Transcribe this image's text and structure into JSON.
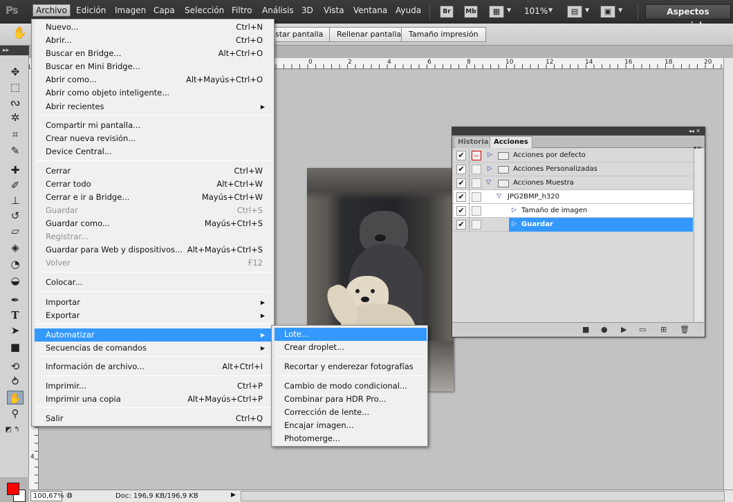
{
  "app": {
    "logo": "Ps",
    "workspace_label": "Aspectos esenciales",
    "zoom": "101%"
  },
  "menubar": [
    "Archivo",
    "Edición",
    "Imagen",
    "Capa",
    "Selección",
    "Filtro",
    "Análisis",
    "3D",
    "Vista",
    "Ventana",
    "Ayuda"
  ],
  "toolbar_boxes": {
    "bridge": "Br",
    "minibridge": "Mb"
  },
  "options_bar": {
    "buttons": [
      "star pantalla",
      "Rellenar pantalla",
      "Tamaño impresión"
    ]
  },
  "ruler": {
    "h_labels": [
      "0",
      "2",
      "4",
      "6",
      "8",
      "10",
      "12",
      "14",
      "16",
      "18",
      "20"
    ],
    "v_labels": [
      "4"
    ]
  },
  "status": {
    "zoom_value": "100,67%",
    "doc_info": "Doc: 196,9 KB/196,9 KB"
  },
  "file_menu": {
    "items": [
      {
        "label": "Nuevo...",
        "shortcut": "Ctrl+N"
      },
      {
        "label": "Abrir...",
        "shortcut": "Ctrl+O"
      },
      {
        "label": "Buscar en Bridge...",
        "shortcut": "Alt+Ctrl+O"
      },
      {
        "label": "Buscar en Mini Bridge...",
        "shortcut": ""
      },
      {
        "label": "Abrir como...",
        "shortcut": "Alt+Mayús+Ctrl+O"
      },
      {
        "label": "Abrir como objeto inteligente...",
        "shortcut": ""
      },
      {
        "label": "Abrir recientes",
        "shortcut": "",
        "submenu": true
      },
      {
        "label": "Compartir mi pantalla...",
        "shortcut": ""
      },
      {
        "label": "Crear nueva revisión...",
        "shortcut": ""
      },
      {
        "label": "Device Central...",
        "shortcut": ""
      },
      {
        "label": "Cerrar",
        "shortcut": "Ctrl+W"
      },
      {
        "label": "Cerrar todo",
        "shortcut": "Alt+Ctrl+W"
      },
      {
        "label": "Cerrar e ir a Bridge...",
        "shortcut": "Mayús+Ctrl+W"
      },
      {
        "label": "Guardar",
        "shortcut": "Ctrl+S",
        "disabled": true
      },
      {
        "label": "Guardar como...",
        "shortcut": "Mayús+Ctrl+S"
      },
      {
        "label": "Registrar...",
        "shortcut": "",
        "disabled": true
      },
      {
        "label": "Guardar para Web y dispositivos...",
        "shortcut": "Alt+Mayús+Ctrl+S"
      },
      {
        "label": "Volver",
        "shortcut": "F12",
        "disabled": true
      },
      {
        "label": "Colocar...",
        "shortcut": ""
      },
      {
        "label": "Importar",
        "shortcut": "",
        "submenu": true
      },
      {
        "label": "Exportar",
        "shortcut": "",
        "submenu": true
      },
      {
        "label": "Automatizar",
        "shortcut": "",
        "submenu": true,
        "highlighted": true
      },
      {
        "label": "Secuencias de comandos",
        "shortcut": "",
        "submenu": true
      },
      {
        "label": "Información de archivo...",
        "shortcut": "Alt+Ctrl+I"
      },
      {
        "label": "Imprimir...",
        "shortcut": "Ctrl+P"
      },
      {
        "label": "Imprimir una copia",
        "shortcut": "Alt+Mayús+Ctrl+P"
      },
      {
        "label": "Salir",
        "shortcut": "Ctrl+Q"
      }
    ]
  },
  "automate_menu": {
    "items": [
      {
        "label": "Lote...",
        "highlighted": true
      },
      {
        "label": "Crear droplet..."
      },
      {
        "label": "Recortar y enderezar fotografías"
      },
      {
        "label": "Cambio de modo condicional..."
      },
      {
        "label": "Combinar para HDR Pro..."
      },
      {
        "label": "Corrección de lente..."
      },
      {
        "label": "Encajar imagen..."
      },
      {
        "label": "Photomerge..."
      }
    ]
  },
  "actions_panel": {
    "tabs": [
      "Historia",
      "Acciones"
    ],
    "active_tab": "Acciones",
    "rows": [
      {
        "label": "Acciones por defecto",
        "level": 0,
        "type": "set",
        "expanded": false
      },
      {
        "label": "Acciones Personalizadas",
        "level": 0,
        "type": "set",
        "expanded": false
      },
      {
        "label": "Acciones Muestra",
        "level": 0,
        "type": "set",
        "expanded": true
      },
      {
        "label": "JPG2BMP_h320",
        "level": 1,
        "type": "action",
        "expanded": true
      },
      {
        "label": "Tamaño de imagen",
        "level": 2,
        "type": "step",
        "expanded": false
      },
      {
        "label": "Guardar",
        "level": 2,
        "type": "step",
        "expanded": false,
        "selected": true
      }
    ]
  },
  "colors": {
    "highlight": "#3399ff",
    "foreground": "#ff0000",
    "background": "#ffffff"
  }
}
